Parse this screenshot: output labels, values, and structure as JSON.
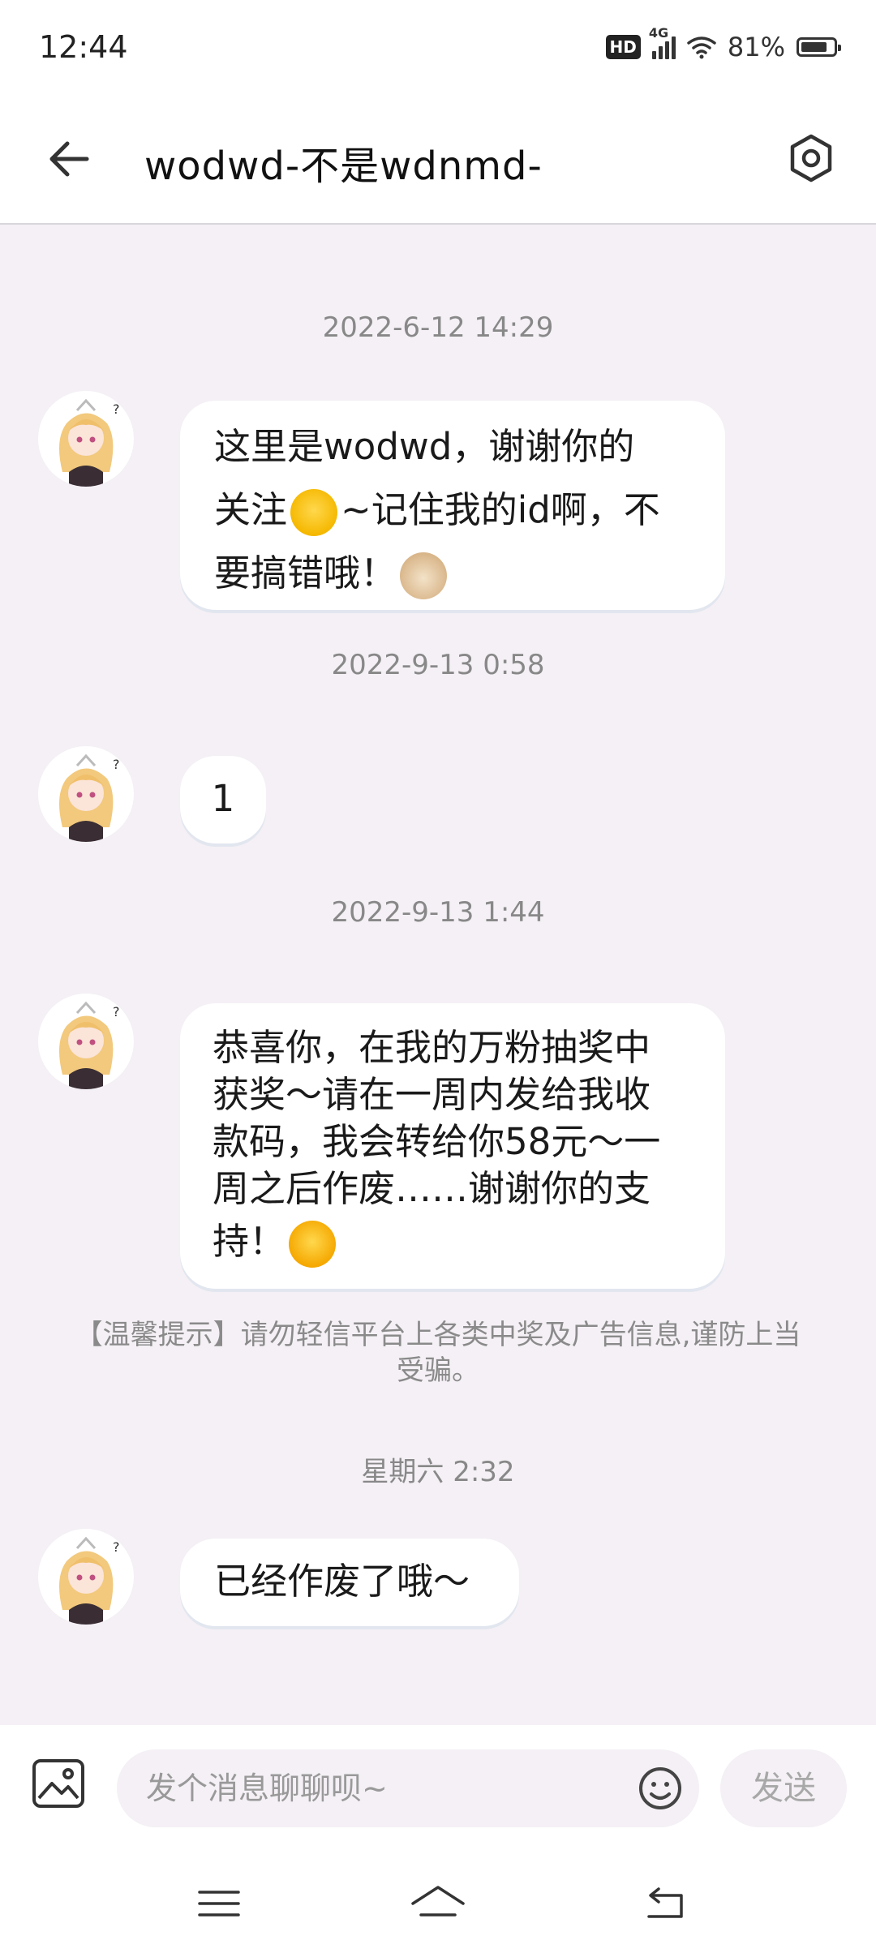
{
  "status_bar": {
    "time": "12:44",
    "hd_label": "HD",
    "network_label": "4G",
    "battery_text": "81%",
    "battery_level": 0.81
  },
  "header": {
    "title": "wodwd-不是wdnmd-"
  },
  "messages": [
    {
      "timestamp": "2022-6-12 14:29",
      "lines": [
        "这里是wodwd，谢谢你的",
        "关注",
        "~记住我的id啊，不",
        "要搞错哦！"
      ]
    },
    {
      "timestamp": "2022-9-13 0:58",
      "text": "1"
    },
    {
      "timestamp": "2022-9-13 1:44",
      "lines": [
        "恭喜你，在我的万粉抽奖中",
        "获奖～请在一周内发给我收",
        "款码，我会转给你58元～一",
        "周之后作废……谢谢你的支",
        "持！"
      ]
    },
    {
      "timestamp": "星期六 2:32",
      "text": "已经作废了哦～"
    }
  ],
  "tip": "【温馨提示】请勿轻信平台上各类中奖及广告信息,谨防上当受骗。",
  "input": {
    "placeholder": "发个消息聊聊呗~",
    "send_label": "发送"
  },
  "colors": {
    "background": "#f4f0f5",
    "bubble": "#ffffff",
    "muted_text": "#888888"
  }
}
